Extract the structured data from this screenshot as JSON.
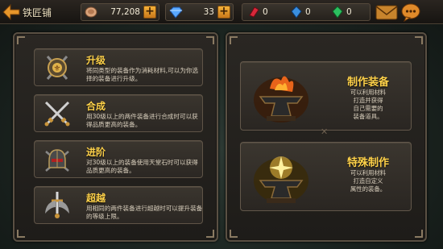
{
  "header": {
    "title": "铁匠铺",
    "gold": "77,208",
    "diamonds": "33",
    "res1": "0",
    "res2": "0",
    "res3": "0"
  },
  "icons": {
    "back": "back-arrow-icon",
    "gold": "coin-icon",
    "diamond": "diamond-icon",
    "res1": "red-crystal-icon",
    "res2": "blue-crystal-icon",
    "res3": "green-crystal-icon",
    "mail": "mail-icon",
    "chat": "chat-icon"
  },
  "left_cards": [
    {
      "title": "升级",
      "desc": "将同类型的装备作为消耗材料,可以为你选择的装备进行升级。",
      "icon": "upgrade-shield-icon"
    },
    {
      "title": "合成",
      "desc": "用30级以上的两件装备进行合成时可以获得品质更高的装备。",
      "icon": "crossed-swords-icon"
    },
    {
      "title": "进阶",
      "desc": "对30级以上的装备使用天堂石时可以获得品质更高的装备。",
      "icon": "helmet-icon"
    },
    {
      "title": "超越",
      "desc": "用相同的两件装备进行超越时可以提升装备的等级上限。",
      "icon": "sword-wings-icon"
    }
  ],
  "right_cards": [
    {
      "title": "制作装备",
      "desc": [
        "可以利用材料",
        "打造并获得",
        "自己需要的",
        "装备道具。"
      ],
      "icon": "anvil-fire-icon"
    },
    {
      "title": "特殊制作",
      "desc": [
        "可以利用材料",
        "打造自定义",
        "属性的装备。"
      ],
      "icon": "anvil-sparkle-icon"
    }
  ],
  "colors": {
    "accent_gold": "#ffd24a",
    "plus_orange": "#e89a2a"
  }
}
